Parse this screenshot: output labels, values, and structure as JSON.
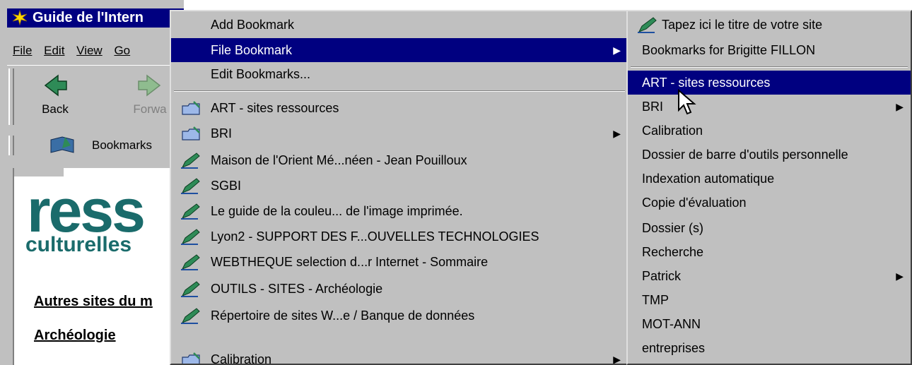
{
  "browser": {
    "title": "Guide de l'Intern",
    "menu": [
      "File",
      "Edit",
      "View",
      "Go"
    ],
    "toolbar": {
      "back": "Back",
      "forward": "Forwa"
    },
    "bookmarks_button": "Bookmarks",
    "page": {
      "logo_big": "ress",
      "logo_sub": "culturelles",
      "links": [
        "Autres sites du m",
        "Archéologie"
      ]
    }
  },
  "bookmark_menu": {
    "items": [
      {
        "label": "Add Bookmark",
        "type": "action"
      },
      {
        "label": "File Bookmark",
        "type": "action",
        "submenu": true,
        "highlighted": true
      },
      {
        "label": "Edit Bookmarks...",
        "type": "action"
      },
      {
        "label": "ART - sites ressources",
        "type": "folder"
      },
      {
        "label": "BRI",
        "type": "folder",
        "submenu": true
      },
      {
        "label": "Maison de l'Orient Mé...néen - Jean Pouilloux",
        "type": "bookmark"
      },
      {
        "label": "SGBI",
        "type": "bookmark"
      },
      {
        "label": "Le guide de la couleu... de l'image imprimée.",
        "type": "bookmark"
      },
      {
        "label": "Lyon2 - SUPPORT DES F...OUVELLES TECHNOLOGIES",
        "type": "bookmark"
      },
      {
        "label": "WEBTHEQUE selection d...r Internet - Sommaire",
        "type": "bookmark"
      },
      {
        "label": "OUTILS - SITES - Archéologie",
        "type": "bookmark"
      },
      {
        "label": "Répertoire de sites W...e / Banque de données",
        "type": "bookmark"
      },
      {
        "label": "Calibration",
        "type": "folder",
        "submenu": true
      }
    ]
  },
  "file_bookmark_submenu": {
    "header_item": "Tapez ici le titre de votre site",
    "items": [
      {
        "label": "Bookmarks for Brigitte FILLON"
      },
      {
        "label": "ART - sites ressources",
        "highlighted": true
      },
      {
        "label": "BRI",
        "submenu": true
      },
      {
        "label": "Calibration"
      },
      {
        "label": "Dossier de barre d'outils personnelle"
      },
      {
        "label": "Indexation automatique"
      },
      {
        "label": "Copie d'évaluation"
      },
      {
        "label": "Dossier (s)"
      },
      {
        "label": "Recherche"
      },
      {
        "label": "Patrick",
        "submenu": true
      },
      {
        "label": "TMP"
      },
      {
        "label": "MOT-ANN"
      },
      {
        "label": "entreprises"
      }
    ]
  },
  "colors": {
    "highlight": "#000080",
    "menu_bg": "#c0c0c0",
    "logo": "#1a6b6b"
  },
  "icons": {
    "folder": "folder-icon",
    "bookmark": "bookmark-pen-icon",
    "submenu": "submenu-arrow-icon"
  }
}
